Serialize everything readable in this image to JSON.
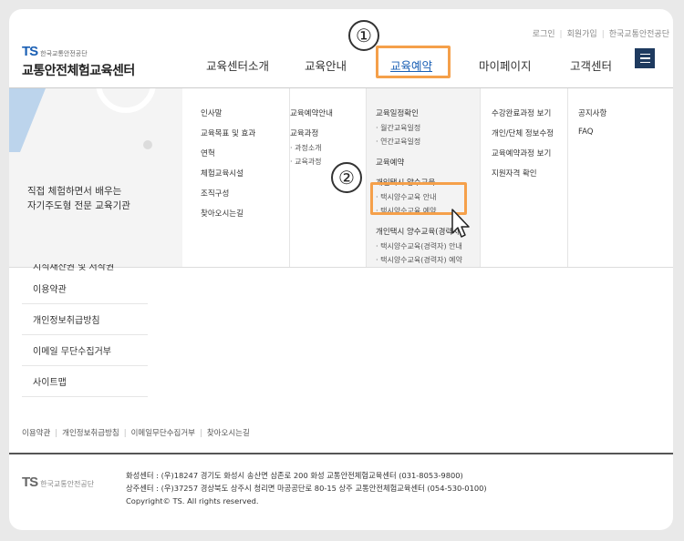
{
  "top_links": [
    "로그인",
    "회원가입",
    "한국교통안전공단"
  ],
  "logo": {
    "ts": "TS",
    "org": "한국교통안전공단",
    "title": "교통안전체험교육센터"
  },
  "gnb": [
    "교육센터소개",
    "교육안내",
    "교육예약",
    "마이페이지",
    "고객센터"
  ],
  "callouts": [
    "①",
    "②"
  ],
  "slogan": {
    "line1": "직접 체험하면서 배우는",
    "line2": "자기주도형 전문 교육기관"
  },
  "mega": {
    "col1": [
      "인사말",
      "교육목표 및 효과",
      "연혁",
      "체험교육시설",
      "조직구성",
      "찾아오시는길"
    ],
    "col2": {
      "items": [
        "교육예약안내",
        "교육과정"
      ],
      "subs": [
        "과정소개",
        "교육과정"
      ]
    },
    "col3": {
      "i1": "교육일정확인",
      "s1": [
        "월간교육일정",
        "연간교육일정"
      ],
      "i2": "교육예약",
      "i3": "개인택시 양수교육",
      "s3": [
        "택시양수교육 안내",
        "택시양수교육 예약"
      ],
      "i4": "개인택시 양수교육(경력자)",
      "s4": [
        "택시양수교육(경력자) 안내",
        "택시양수교육(경력자) 예약"
      ]
    },
    "col4": [
      "수강완료과정 보기",
      "개인/단체 정보수정",
      "교육예약과정 보기",
      "지원자격 확인"
    ],
    "col5": [
      "공지사항",
      "FAQ"
    ]
  },
  "side_partial": "지식재산권 및 저작권",
  "side_list": [
    "이용약관",
    "개인정보취급방침",
    "이메일 무단수집거부",
    "사이트맵"
  ],
  "footer_links": [
    "이용약관",
    "개인정보취급방침",
    "이메일무단수집거부",
    "찾아오시는길"
  ],
  "footer": {
    "ts": "TS",
    "org": "한국교통안전공단",
    "line1": "화성센터 : (우)18247 경기도 화성시 송산면 삼존로 200 화성 교통안전체험교육센터 (031-8053-9800)",
    "line2": "상주센터 : (우)37257 경상북도 상주시 청리면 마공공단로 80-15 상주 교통안전체험교육센터 (054-530-0100)",
    "line3": "Copyright© TS. All rights reserved."
  },
  "colors": {
    "brand": "#1a5fb4",
    "highlight": "#f5a04a",
    "menu_btn": "#1e3a5f"
  }
}
